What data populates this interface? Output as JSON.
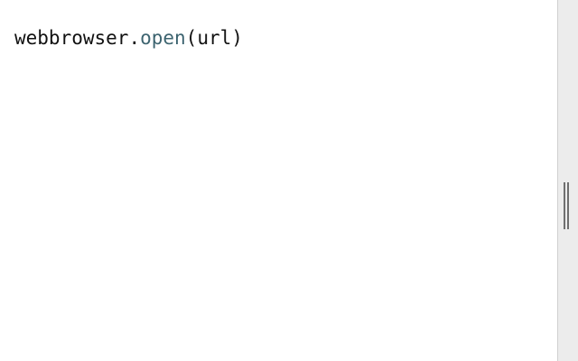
{
  "editor": {
    "code": {
      "object": "webbrowser",
      "dot": ".",
      "method": "open",
      "open_paren": "(",
      "argument": "url",
      "close_paren": ")"
    }
  },
  "colors": {
    "background": "#ffffff",
    "text": "#111111",
    "method_token": "#3d6470",
    "scrollbar_track": "#ececec",
    "scrollbar_grip": "#6f6f6f"
  },
  "icons": {
    "scrollbar_handle": "double-bar-grip-icon"
  }
}
